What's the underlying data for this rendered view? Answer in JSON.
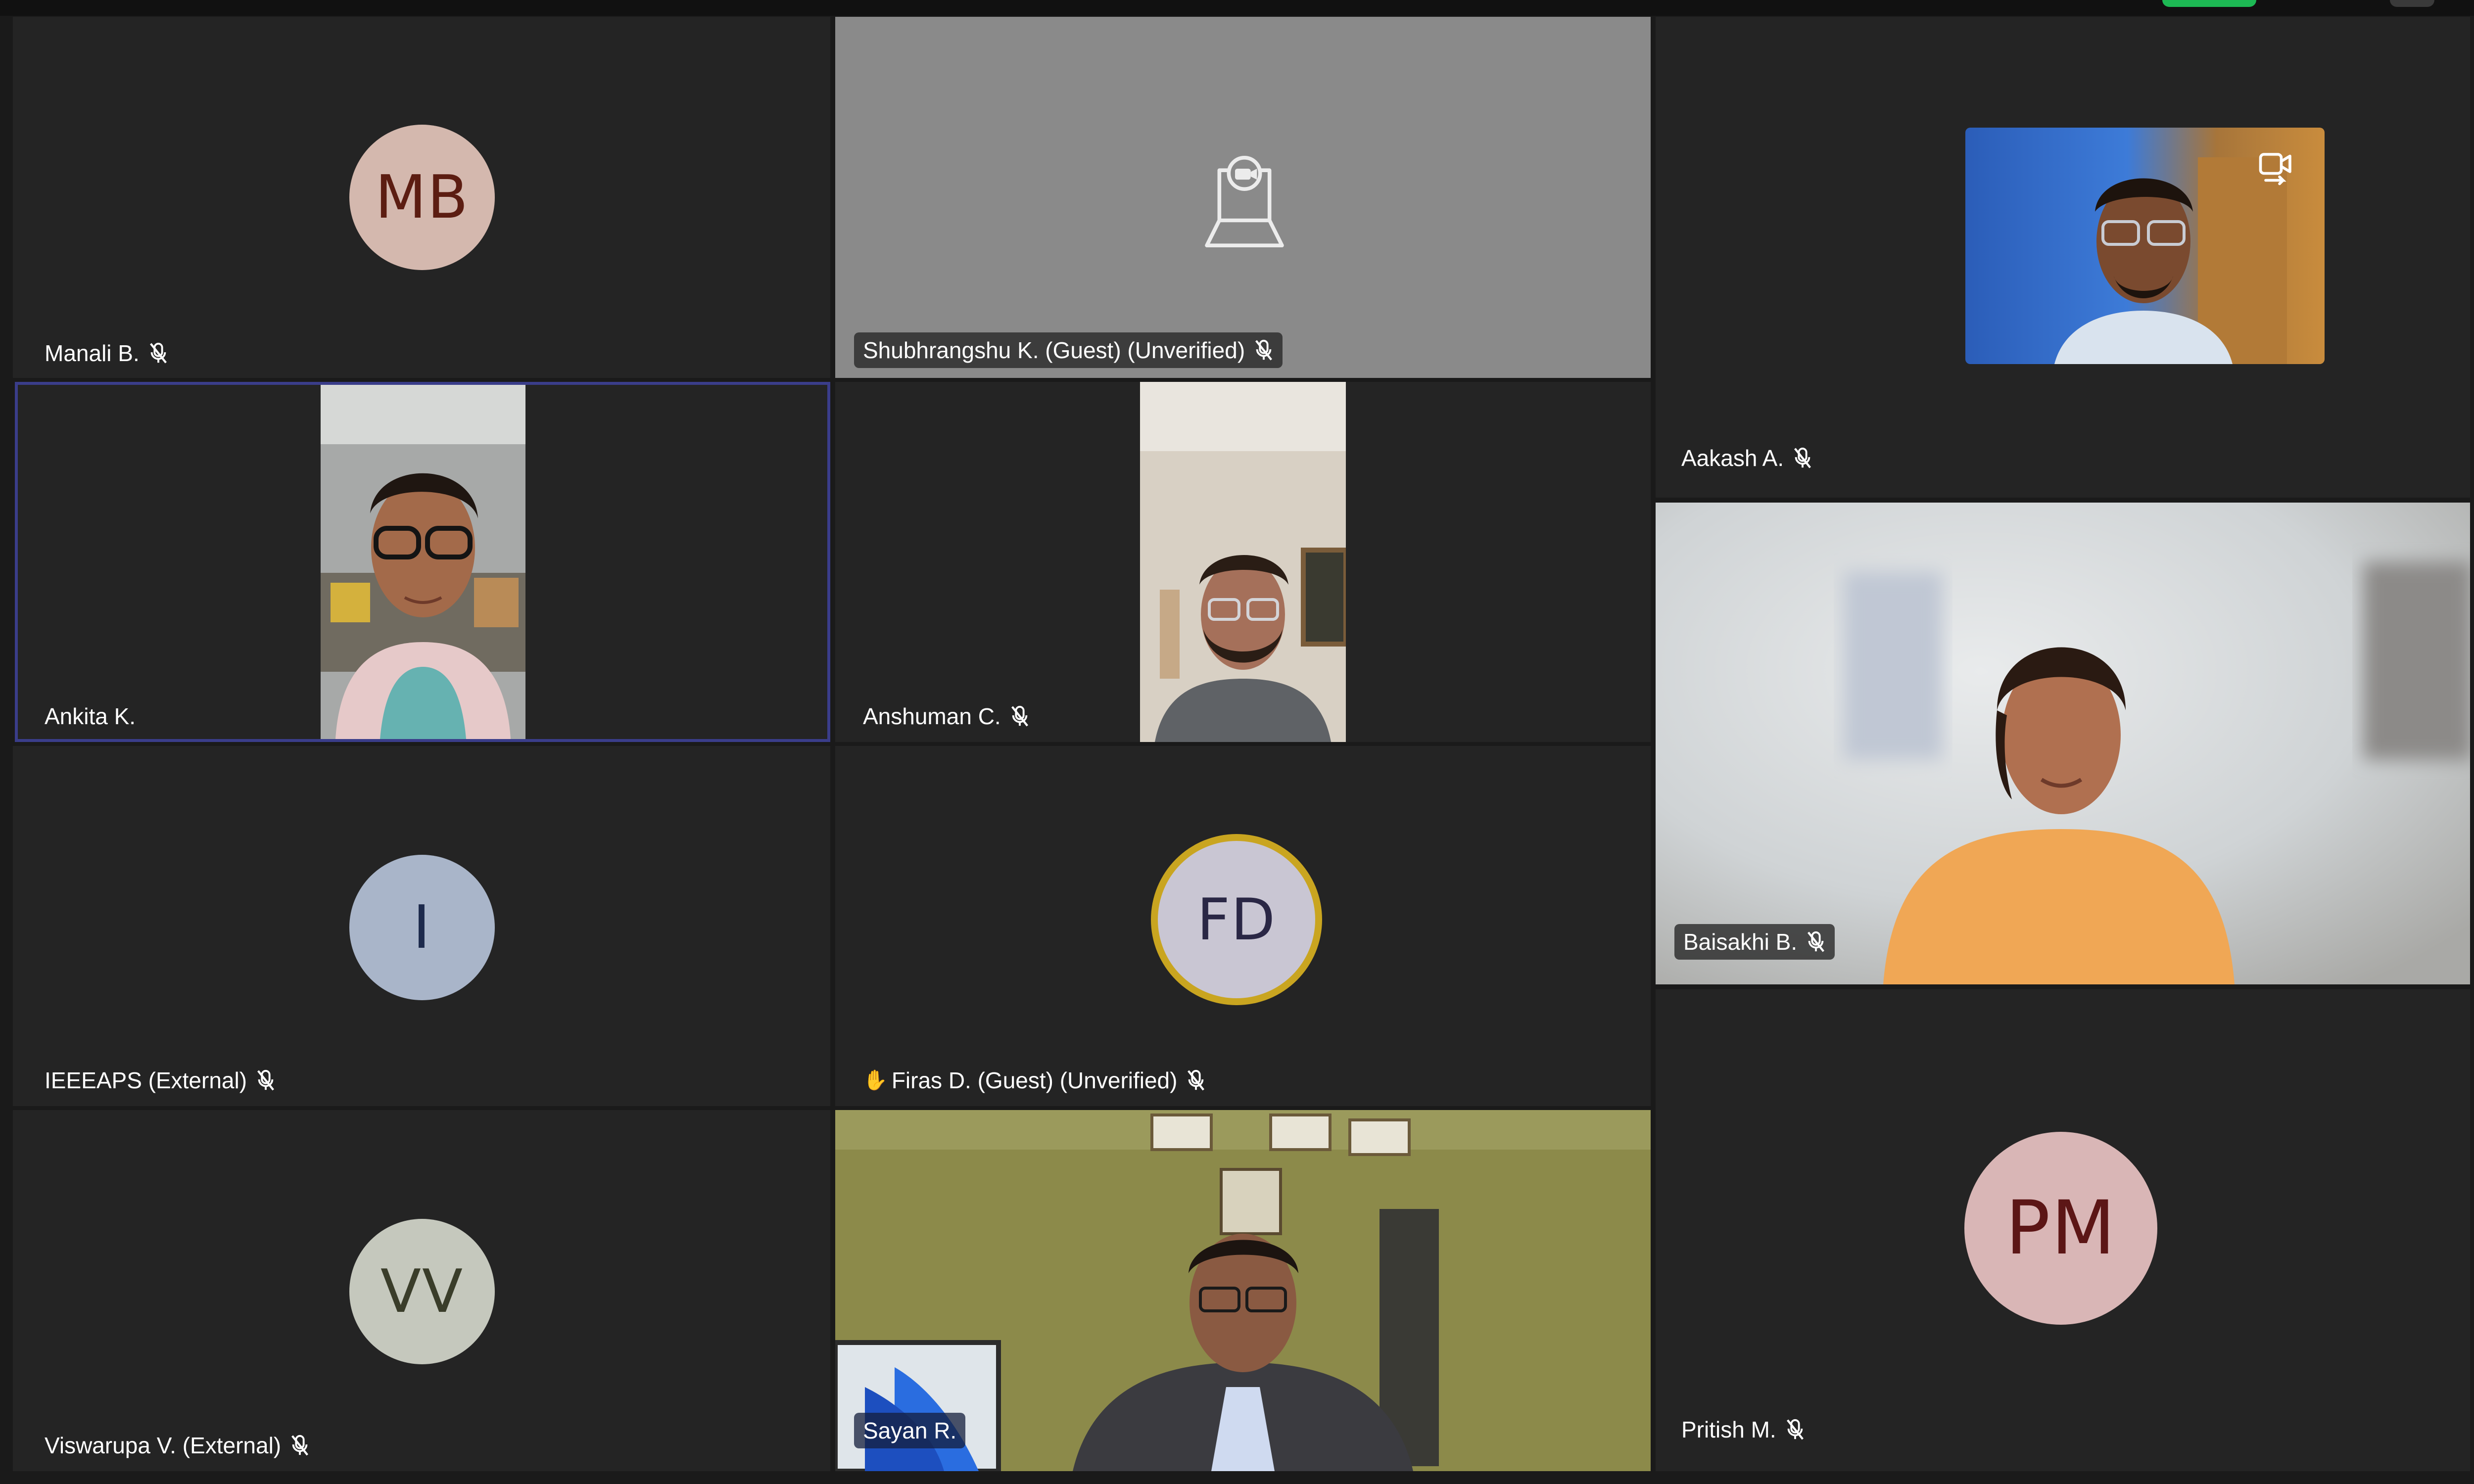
{
  "participants": {
    "manali": {
      "initials": "MB",
      "name": "Manali B."
    },
    "shubhrangshu": {
      "name": "Shubhrangshu K. (Guest) (Unverified)"
    },
    "aakash": {
      "name": "Aakash A."
    },
    "ankita": {
      "name": "Ankita K."
    },
    "anshuman": {
      "name": "Anshuman C."
    },
    "baisakhi": {
      "name": "Baisakhi B."
    },
    "ieeeaps": {
      "initials": "I",
      "name": "IEEEAPS (External)"
    },
    "firas": {
      "initials": "FD",
      "name": "Firas D. (Guest) (Unverified)"
    },
    "viswarupa": {
      "initials": "VV",
      "name": "Viswarupa V. (External)"
    },
    "sayan": {
      "name": "Sayan R."
    },
    "pritish": {
      "initials": "PM",
      "name": "Pritish M."
    }
  },
  "colors": {
    "tile_bg": "#242424",
    "camoff_grey": "#8a8a8a",
    "active_border": "#3a3d8a",
    "raised_hand_ring": "#c9a520",
    "mb_avatar": "#d4b8ae",
    "mb_text": "#5c1d12",
    "i_avatar": "#a9b5c9",
    "i_text": "#1d2a4c",
    "fd_avatar": "#c9c6d3",
    "fd_text": "#2a2745",
    "vv_avatar": "#c5c8bd",
    "vv_text": "#3a3d2a",
    "pm_avatar": "#d9b6b6",
    "pm_text": "#5c1616"
  },
  "icons": {
    "muted_mic": "mic-muted-icon",
    "camera_off": "camera-off-laptop-icon",
    "raised_hand": "raised-hand-icon",
    "switch_camera": "camera-switch-icon"
  },
  "glyphs": {
    "raised_hand": "✋"
  }
}
